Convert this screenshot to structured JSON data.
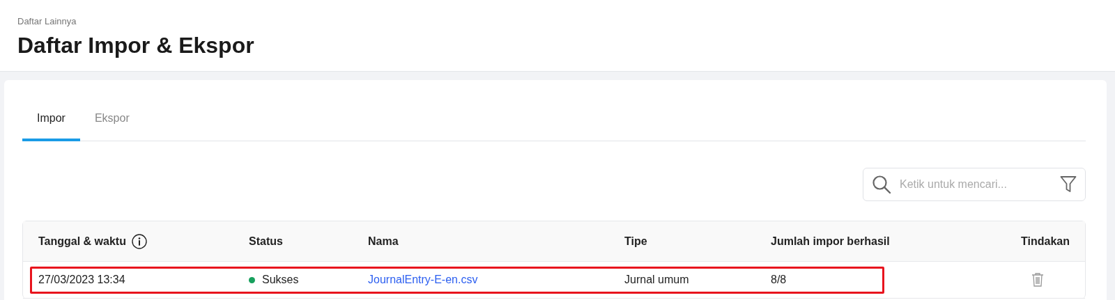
{
  "breadcrumb": "Daftar Lainnya",
  "title": "Daftar Impor & Ekspor",
  "tabs": [
    {
      "label": "Impor",
      "selected": true
    },
    {
      "label": "Ekspor",
      "selected": false
    }
  ],
  "search": {
    "placeholder": "Ketik untuk mencari..."
  },
  "table": {
    "columns": [
      {
        "label": "Tanggal & waktu",
        "info": true
      },
      {
        "label": "Status",
        "info": false
      },
      {
        "label": "Nama",
        "info": false
      },
      {
        "label": "Tipe",
        "info": false
      },
      {
        "label": "Jumlah impor berhasil",
        "info": false
      },
      {
        "label": "Tindakan",
        "info": false
      }
    ],
    "rows": [
      {
        "datetime": "27/03/2023 13:34",
        "status": "Sukses",
        "color": "#17a05d",
        "name": "JournalEntry-E-en.csv",
        "type": "Jurnal umum",
        "success_count": "8/8",
        "highlighted": true
      }
    ]
  }
}
